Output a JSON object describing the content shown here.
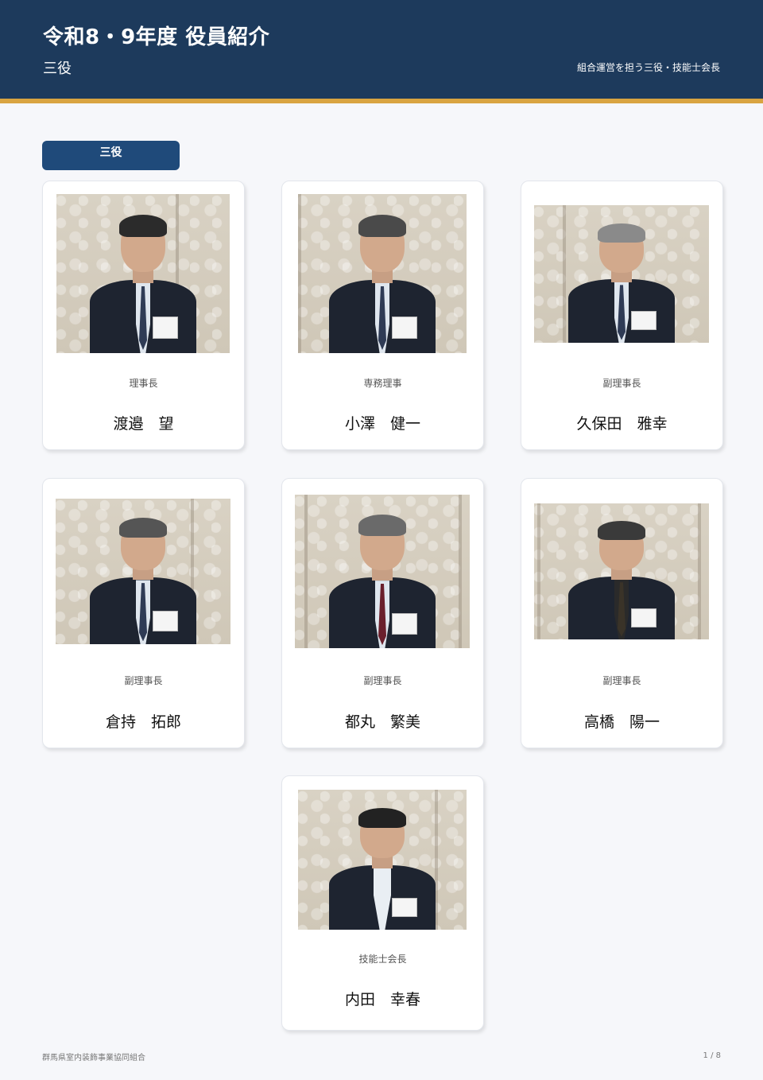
{
  "header": {
    "title": "令和8・9年度 役員紹介",
    "subtitle": "三役",
    "right_text": "組合運営を担う三役・技能士会長"
  },
  "section": {
    "label": "三役"
  },
  "members": [
    {
      "role": "理事長",
      "name": "渡邉　望"
    },
    {
      "role": "専務理事",
      "name": "小澤　健一"
    },
    {
      "role": "副理事長",
      "name": "久保田　雅幸"
    },
    {
      "role": "副理事長",
      "name": "倉持　拓郎"
    },
    {
      "role": "副理事長",
      "name": "都丸　繁美"
    },
    {
      "role": "副理事長",
      "name": "高橋　陽一"
    },
    {
      "role": "技能士会長",
      "name": "内田　幸春"
    }
  ],
  "footer": {
    "organization": "群馬県室内装飾事業協同組合",
    "page": "1 / 8"
  }
}
